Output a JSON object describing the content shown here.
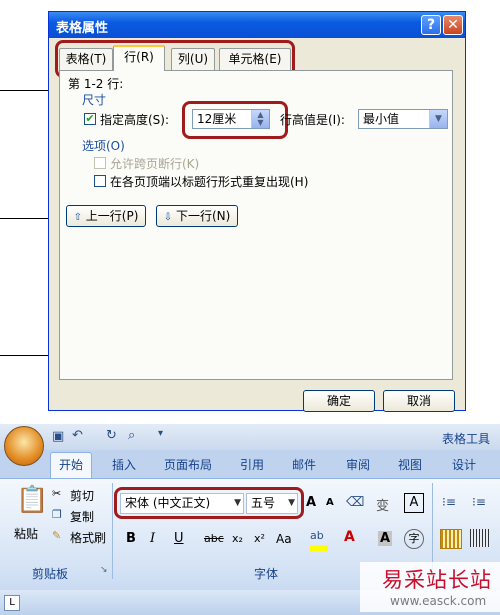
{
  "dialog": {
    "title": "表格属性",
    "help_label": "?",
    "close_label": "✕",
    "tabs": [
      {
        "label": "表格(T)"
      },
      {
        "label": "行(R)"
      },
      {
        "label": "列(U)"
      },
      {
        "label": "单元格(E)"
      }
    ],
    "rows_label": "第 1-2 行:",
    "size_section": "尺寸",
    "specify_height_label": "指定高度(S):",
    "height_value": "12厘米",
    "row_height_is_label": "行高值是(I):",
    "row_height_mode": "最小值",
    "options_section": "选项(O)",
    "allow_break_label": "允许跨页断行(K)",
    "repeat_header_label": "在各页顶端以标题行形式重复出现(H)",
    "prev_row_label": "上一行(P)",
    "next_row_label": "下一行(N)",
    "ok_label": "确定",
    "cancel_label": "取消"
  },
  "ribbon": {
    "table_tools_label": "表格工具",
    "tabs": [
      {
        "label": "开始"
      },
      {
        "label": "插入"
      },
      {
        "label": "页面布局"
      },
      {
        "label": "引用"
      },
      {
        "label": "邮件"
      },
      {
        "label": "审阅"
      },
      {
        "label": "视图"
      },
      {
        "label": "设计"
      }
    ],
    "clipboard": {
      "paste_label": "粘贴",
      "cut_label": "剪切",
      "copy_label": "复制",
      "format_painter_label": "格式刷",
      "group_label": "剪贴板"
    },
    "font": {
      "font_name": "宋体 (中文正文)",
      "font_size": "五号",
      "group_label": "字体",
      "bold": "B",
      "italic": "I",
      "underline": "U",
      "strike": "abc",
      "subscript": "x₂",
      "superscript": "x²",
      "change_case": "Aa",
      "grow": "A",
      "shrink": "A",
      "char_border": "A",
      "enclose": "字",
      "phonetic": "变"
    }
  },
  "watermark": {
    "text": "易采站长站",
    "url": "www.easck.com"
  }
}
